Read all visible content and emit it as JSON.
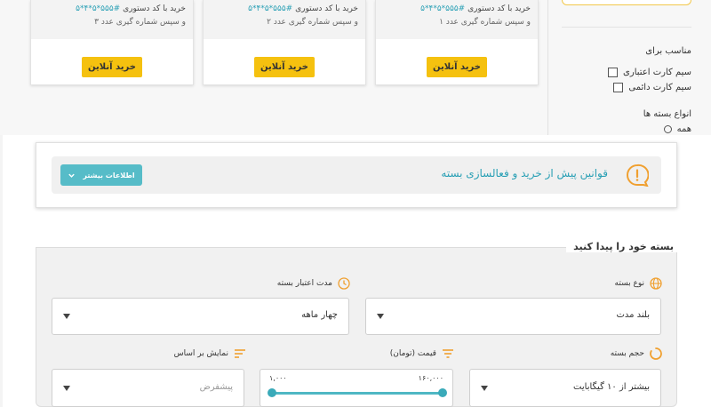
{
  "cards": [
    {
      "buy_text": "خرید با کد دستوری",
      "code": "#۵۵۵*۵*۴*۵",
      "instruction": "و سپس شماره گیری عدد ۳",
      "button": "خرید آنلاین"
    },
    {
      "buy_text": "خرید با کد دستوری",
      "code": "#۵۵۵*۵*۴*۵",
      "instruction": "و سپس شماره گیری عدد ۲",
      "button": "خرید آنلاین"
    },
    {
      "buy_text": "خرید با کد دستوری",
      "code": "#۵۵۵*۵*۴*۵",
      "instruction": "و سپس شماره گیری عدد ۱",
      "button": "خرید آنلاین"
    }
  ],
  "filters": {
    "suitable_title": "مناسب برای",
    "options": [
      "سیم کارت اعتباری",
      "سیم کارت دائمی"
    ],
    "package_types_title": "انواع بسته ها",
    "all_option": "همه"
  },
  "rules": {
    "title": "قوانین پیش از خرید و فعالسازی بسته",
    "button": "اطلاعات بیشتر",
    "icon": "question-bubble-icon",
    "accent": "#f0a030"
  },
  "finder": {
    "title": "بسته خود را پیدا کنید",
    "package_type": {
      "label": "نوع بسته",
      "value": "بلند مدت",
      "icon": "globe-icon"
    },
    "validity": {
      "label": "مدت اعتبار بسته",
      "value": "چهار ماهه",
      "icon": "clock-icon"
    },
    "volume": {
      "label": "حجم بسته",
      "value": "بیشتر از ۱۰ گیگابایت",
      "icon": "spinner-icon"
    },
    "price": {
      "label": "قیمت (تومان)",
      "max": "۱۶۰,۰۰۰",
      "min": "۱,۰۰۰",
      "icon": "filter-icon"
    },
    "sort": {
      "label": "نمایش بر اساس",
      "placeholder": "پیشفرض",
      "icon": "sort-icon"
    }
  },
  "colors": {
    "yellow": "#f5c10f",
    "teal": "#56bcc8",
    "orange": "#f0a030"
  }
}
